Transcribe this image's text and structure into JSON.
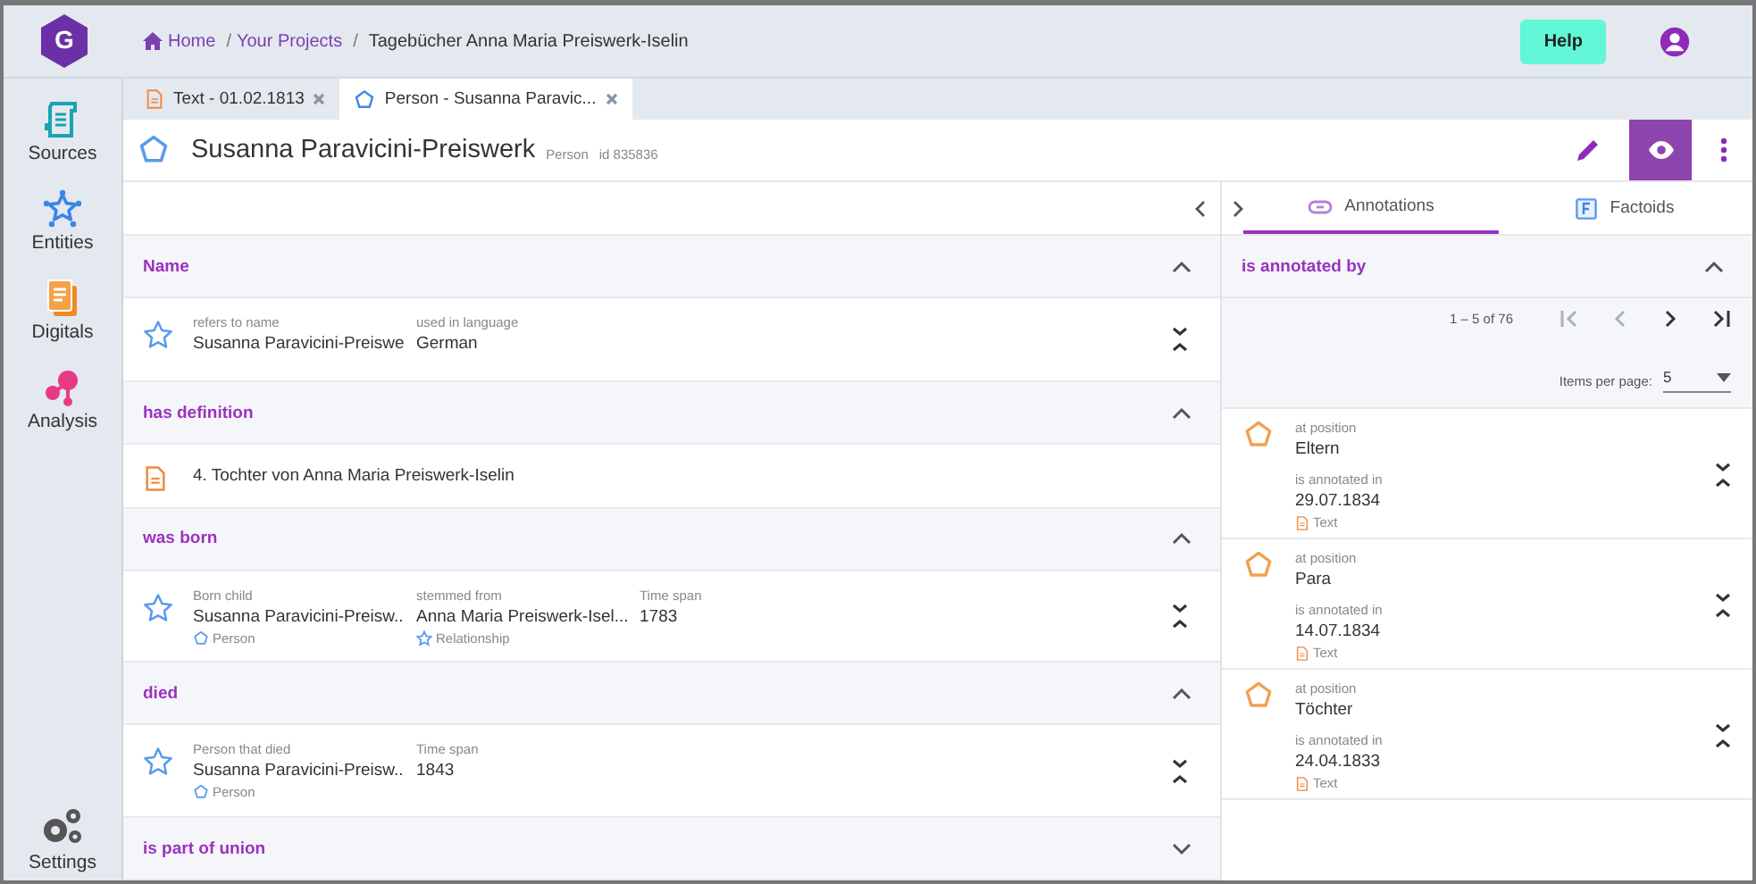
{
  "logo": "G",
  "breadcrumb": [
    "Home",
    "Your Projects",
    "Tagebücher Anna Maria Preiswerk-Iselin"
  ],
  "breadcrumb_separator": "/",
  "help_button": "Help",
  "sidebar": {
    "items": [
      {
        "label": "Sources",
        "kind": "sources"
      },
      {
        "label": "Entities",
        "kind": "entities"
      },
      {
        "label": "Digitals",
        "kind": "digitals"
      },
      {
        "label": "Analysis",
        "kind": "analysis"
      }
    ],
    "settings": "Settings"
  },
  "tabs": [
    {
      "label": "Text - 01.02.1813",
      "kind": "text",
      "selected": false
    },
    {
      "label": "Person - Susanna Paravic...",
      "kind": "person",
      "selected": true
    }
  ],
  "entity": {
    "title": "Susanna Paravicini-Preiswerk",
    "type": "Person",
    "id": "id 835836"
  },
  "view_buttons": [
    {
      "kind": "edit",
      "selected": false
    },
    {
      "kind": "view",
      "selected": true
    }
  ],
  "sections": [
    {
      "title": "Name",
      "expanded": true,
      "kind": "fields",
      "fields": [
        {
          "label": "refers to name",
          "value": "Susanna Paravicini-Preiswe"
        },
        {
          "label": "used in language",
          "value": "German"
        }
      ]
    },
    {
      "title": "has definition",
      "expanded": true,
      "kind": "definition",
      "text": "4. Tochter von Anna Maria Preiswerk-Iselin"
    },
    {
      "title": "was born",
      "expanded": true,
      "kind": "fields",
      "fields": [
        {
          "label": "Born child",
          "value": "Susanna Paravicini-Preisw..",
          "type": "Person",
          "kind": "person"
        },
        {
          "label": "stemmed from",
          "value": "Anna Maria Preiswerk-Isel...",
          "type": "Relationship",
          "kind": "relationship"
        },
        {
          "label": "Time span",
          "value": "1783"
        }
      ]
    },
    {
      "title": "died",
      "expanded": true,
      "kind": "fields",
      "fields": [
        {
          "label": "Person that died",
          "value": "Susanna Paravicini-Preisw..",
          "type": "Person",
          "kind": "person"
        },
        {
          "label": "Time span",
          "value": "1843"
        }
      ]
    },
    {
      "title": "is part of union",
      "expanded": false
    }
  ],
  "right_tabs": [
    {
      "label": "Annotations",
      "kind": "link",
      "selected": true
    },
    {
      "label": "Factoids",
      "kind": "factoid",
      "selected": false
    }
  ],
  "annotations": {
    "title": "is annotated by",
    "expanded": true,
    "range": "1 – 5 of 76",
    "pager_buttons": [
      {
        "kind": "first",
        "disabled": true
      },
      {
        "kind": "prev",
        "disabled": true
      },
      {
        "kind": "next",
        "disabled": false
      },
      {
        "kind": "last",
        "disabled": false
      }
    ],
    "items_per_page_label": "Items per page:",
    "items_per_page": "5",
    "items": [
      {
        "position_label": "at position",
        "position": "Eltern",
        "annotated_label": "is annotated in",
        "date": "29.07.1834",
        "type": "Text"
      },
      {
        "position_label": "at position",
        "position": "Para",
        "annotated_label": "is annotated in",
        "date": "14.07.1834",
        "type": "Text"
      },
      {
        "position_label": "at position",
        "position": "Töchter",
        "annotated_label": "is annotated in",
        "date": "24.04.1833",
        "type": "Text"
      }
    ]
  }
}
